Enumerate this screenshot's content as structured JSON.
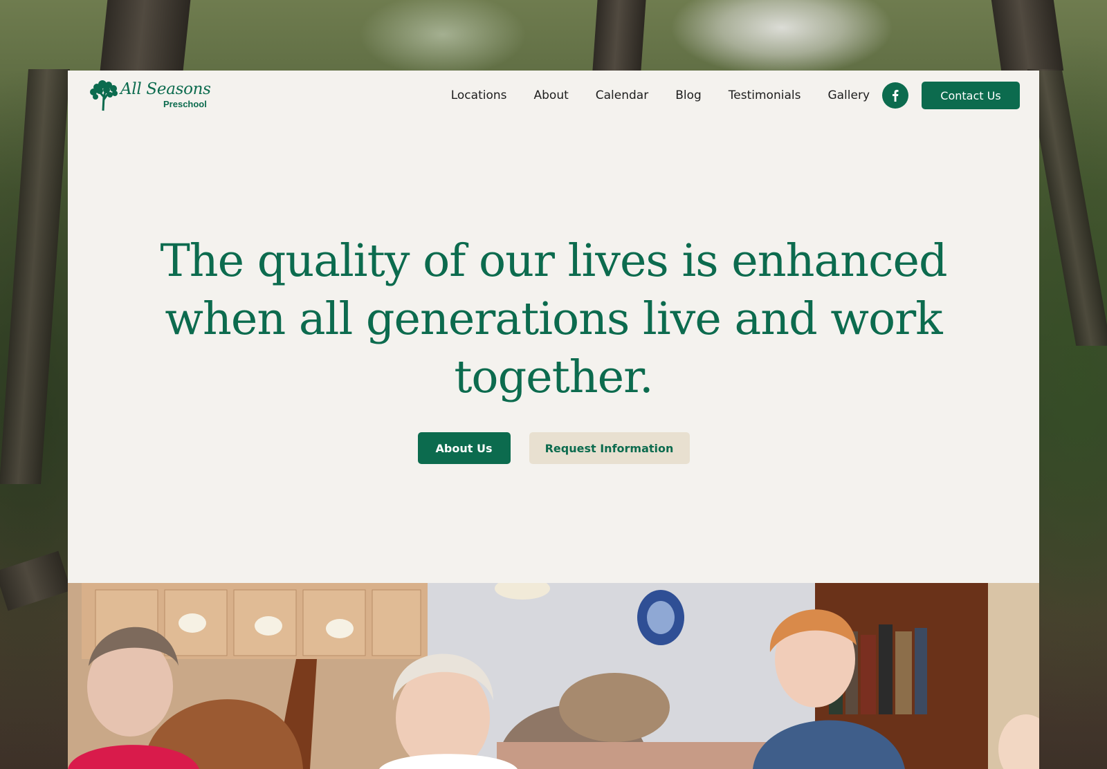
{
  "brand": {
    "name": "All Seasons",
    "sub": "Preschool",
    "accent_color": "#0c6b4e"
  },
  "nav": {
    "items": [
      {
        "label": "Locations"
      },
      {
        "label": "About"
      },
      {
        "label": "Calendar"
      },
      {
        "label": "Blog"
      },
      {
        "label": "Testimonials"
      },
      {
        "label": "Gallery"
      }
    ],
    "social_icon": "facebook-icon",
    "contact_label": "Contact Us"
  },
  "hero": {
    "title": "The quality of our lives is enhanced when all generations live and work together.",
    "primary_button": "About Us",
    "secondary_button": "Request Information"
  },
  "colors": {
    "page_card": "#f4f2ee",
    "primary": "#0c6b4e",
    "secondary_button_bg": "#e8e0d0"
  }
}
